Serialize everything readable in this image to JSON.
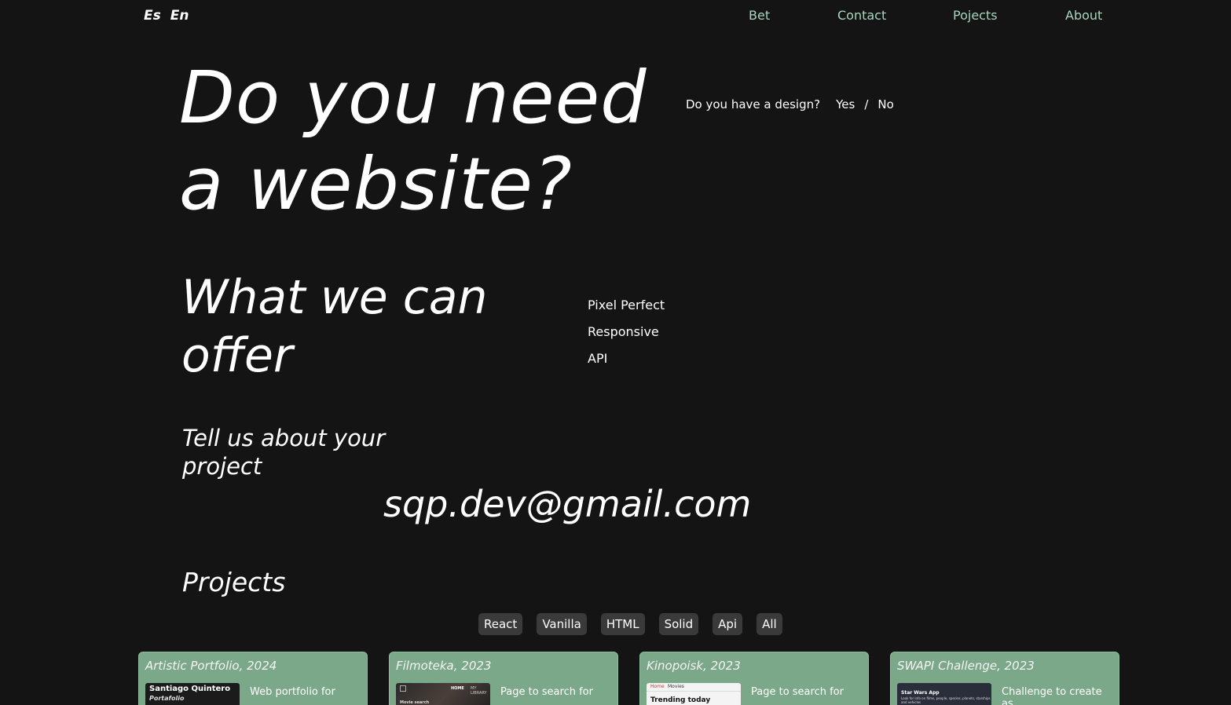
{
  "header": {
    "languages": [
      "Es",
      "En"
    ],
    "nav": {
      "bet": "Bet",
      "contact": "Contact",
      "projects": "Pojects",
      "about": "About"
    }
  },
  "hero": {
    "title_line1": "Do you need",
    "title_line2": "a website?",
    "design_question": "Do you have a design?",
    "yes": "Yes",
    "separator": "/",
    "no": "No"
  },
  "offer": {
    "title_line1": "What we can",
    "title_line2": "offer",
    "items": [
      "Pixel Perfect",
      "Responsive",
      "API"
    ]
  },
  "contact": {
    "title_line1": "Tell us about your",
    "title_line2": "project",
    "email": "sqp.dev@gmail.com"
  },
  "projects": {
    "title": "Projects",
    "filters": [
      "React",
      "Vanilla",
      "HTML",
      "Solid",
      "Api",
      "All"
    ],
    "cards": [
      {
        "title": "Artistic Portfolio, 2024",
        "description": "Web portfolio for",
        "thumb_title": "Santiago Quintero",
        "thumb_subtitle": "Portafolio"
      },
      {
        "title": "Filmoteka, 2023",
        "description": "Page to search for",
        "thumb_title": "HOME",
        "thumb_right": "MY LIBRARY",
        "thumb_subtitle": "Movie search"
      },
      {
        "title": "Kinopoisk, 2023",
        "description": "Page to search for",
        "thumb_nav_home": "Home",
        "thumb_nav_movies": "Movies",
        "thumb_title": "Trending today"
      },
      {
        "title": "SWAPI Challenge, 2023",
        "description": "Challenge to create as",
        "thumb_title": "Star Wars App",
        "thumb_subtitle": "Look for info on films, people, species, planets, starships and vehicles"
      }
    ]
  },
  "colors": {
    "background": "#141414",
    "nav_link": "#a8d5be",
    "card_bg": "#7ca88a",
    "filter_bg": "#3a3a3a"
  }
}
